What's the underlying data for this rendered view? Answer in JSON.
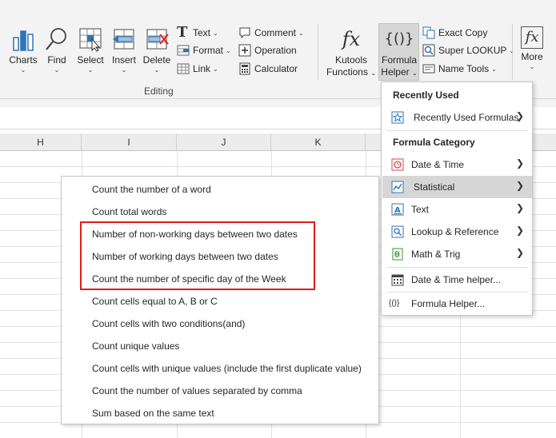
{
  "ribbon": {
    "charts": "Charts",
    "find": "Find",
    "select": "Select",
    "insert": "Insert",
    "delete": "Delete",
    "text": "Text",
    "format": "Format",
    "link": "Link",
    "comment": "Comment",
    "operation": "Operation",
    "calculator": "Calculator",
    "group_label": "Editing",
    "kutools_line1": "Kutools",
    "kutools_line2": "Functions",
    "fh_line1": "Formula",
    "fh_line2": "Helper",
    "exact_copy": "Exact Copy",
    "super_lookup": "Super LOOKUP",
    "name_tools": "Name Tools",
    "more": "More"
  },
  "columns": [
    "H",
    "I",
    "J",
    "K"
  ],
  "formula_helper_menu": {
    "recently_used_heading": "Recently Used",
    "recently_used_formulas": "Recently Used Formulas",
    "category_heading": "Formula Category",
    "items": [
      {
        "label": "Date & Time",
        "icon": "date-time-icon"
      },
      {
        "label": "Statistical",
        "icon": "statistical-icon"
      },
      {
        "label": "Text",
        "icon": "text-category-icon"
      },
      {
        "label": "Lookup & Reference",
        "icon": "lookup-icon"
      },
      {
        "label": "Math & Trig",
        "icon": "math-trig-icon"
      }
    ],
    "date_time_helper": "Date & Time helper...",
    "formula_helper": "Formula Helper..."
  },
  "statistical_submenu": {
    "items": [
      "Count the number of a word",
      "Count total words",
      "Number of non-working days between two dates",
      "Number of working days between two dates",
      "Count the number of specific day of the Week",
      "Count cells equal to A, B or C",
      "Count cells with two conditions(and)",
      "Count unique values",
      "Count cells with unique values (include the first duplicate value)",
      "Count the number of values separated by comma",
      "Sum based on the same text"
    ]
  },
  "colors": {
    "highlight_box": "#e21b1b",
    "selected_item_bg": "#d6d6d6",
    "ribbon_bg": "#f3f3f3",
    "icon_blue": "#2e75b6"
  }
}
